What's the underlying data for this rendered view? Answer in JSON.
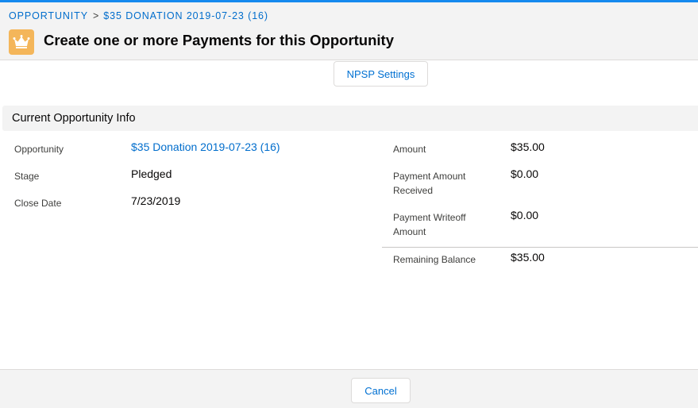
{
  "breadcrumb": {
    "object": "OPPORTUNITY",
    "separator": ">",
    "record": "$35 DONATION 2019-07-23 (16)"
  },
  "header": {
    "icon": "crown-icon",
    "title": "Create one or more Payments for this Opportunity"
  },
  "toolbar": {
    "settings_label": "NPSP Settings"
  },
  "section": {
    "title": "Current Opportunity Info"
  },
  "left_fields": [
    {
      "label": "Opportunity",
      "value": "$35 Donation 2019-07-23 (16)"
    },
    {
      "label": "Stage",
      "value": "Pledged"
    },
    {
      "label": "Close Date",
      "value": "7/23/2019"
    }
  ],
  "right_fields": [
    {
      "label": "Amount",
      "value": "$35.00"
    },
    {
      "label": "Payment Amount Received",
      "value": "$0.00"
    },
    {
      "label": "Payment Writeoff Amount",
      "value": "$0.00"
    },
    {
      "label": "Remaining Balance",
      "value": "$35.00"
    }
  ],
  "footer": {
    "cancel_label": "Cancel"
  },
  "colors": {
    "accent": "#1589ee",
    "link": "#006dcc",
    "icon_bg": "#f4b65a"
  }
}
